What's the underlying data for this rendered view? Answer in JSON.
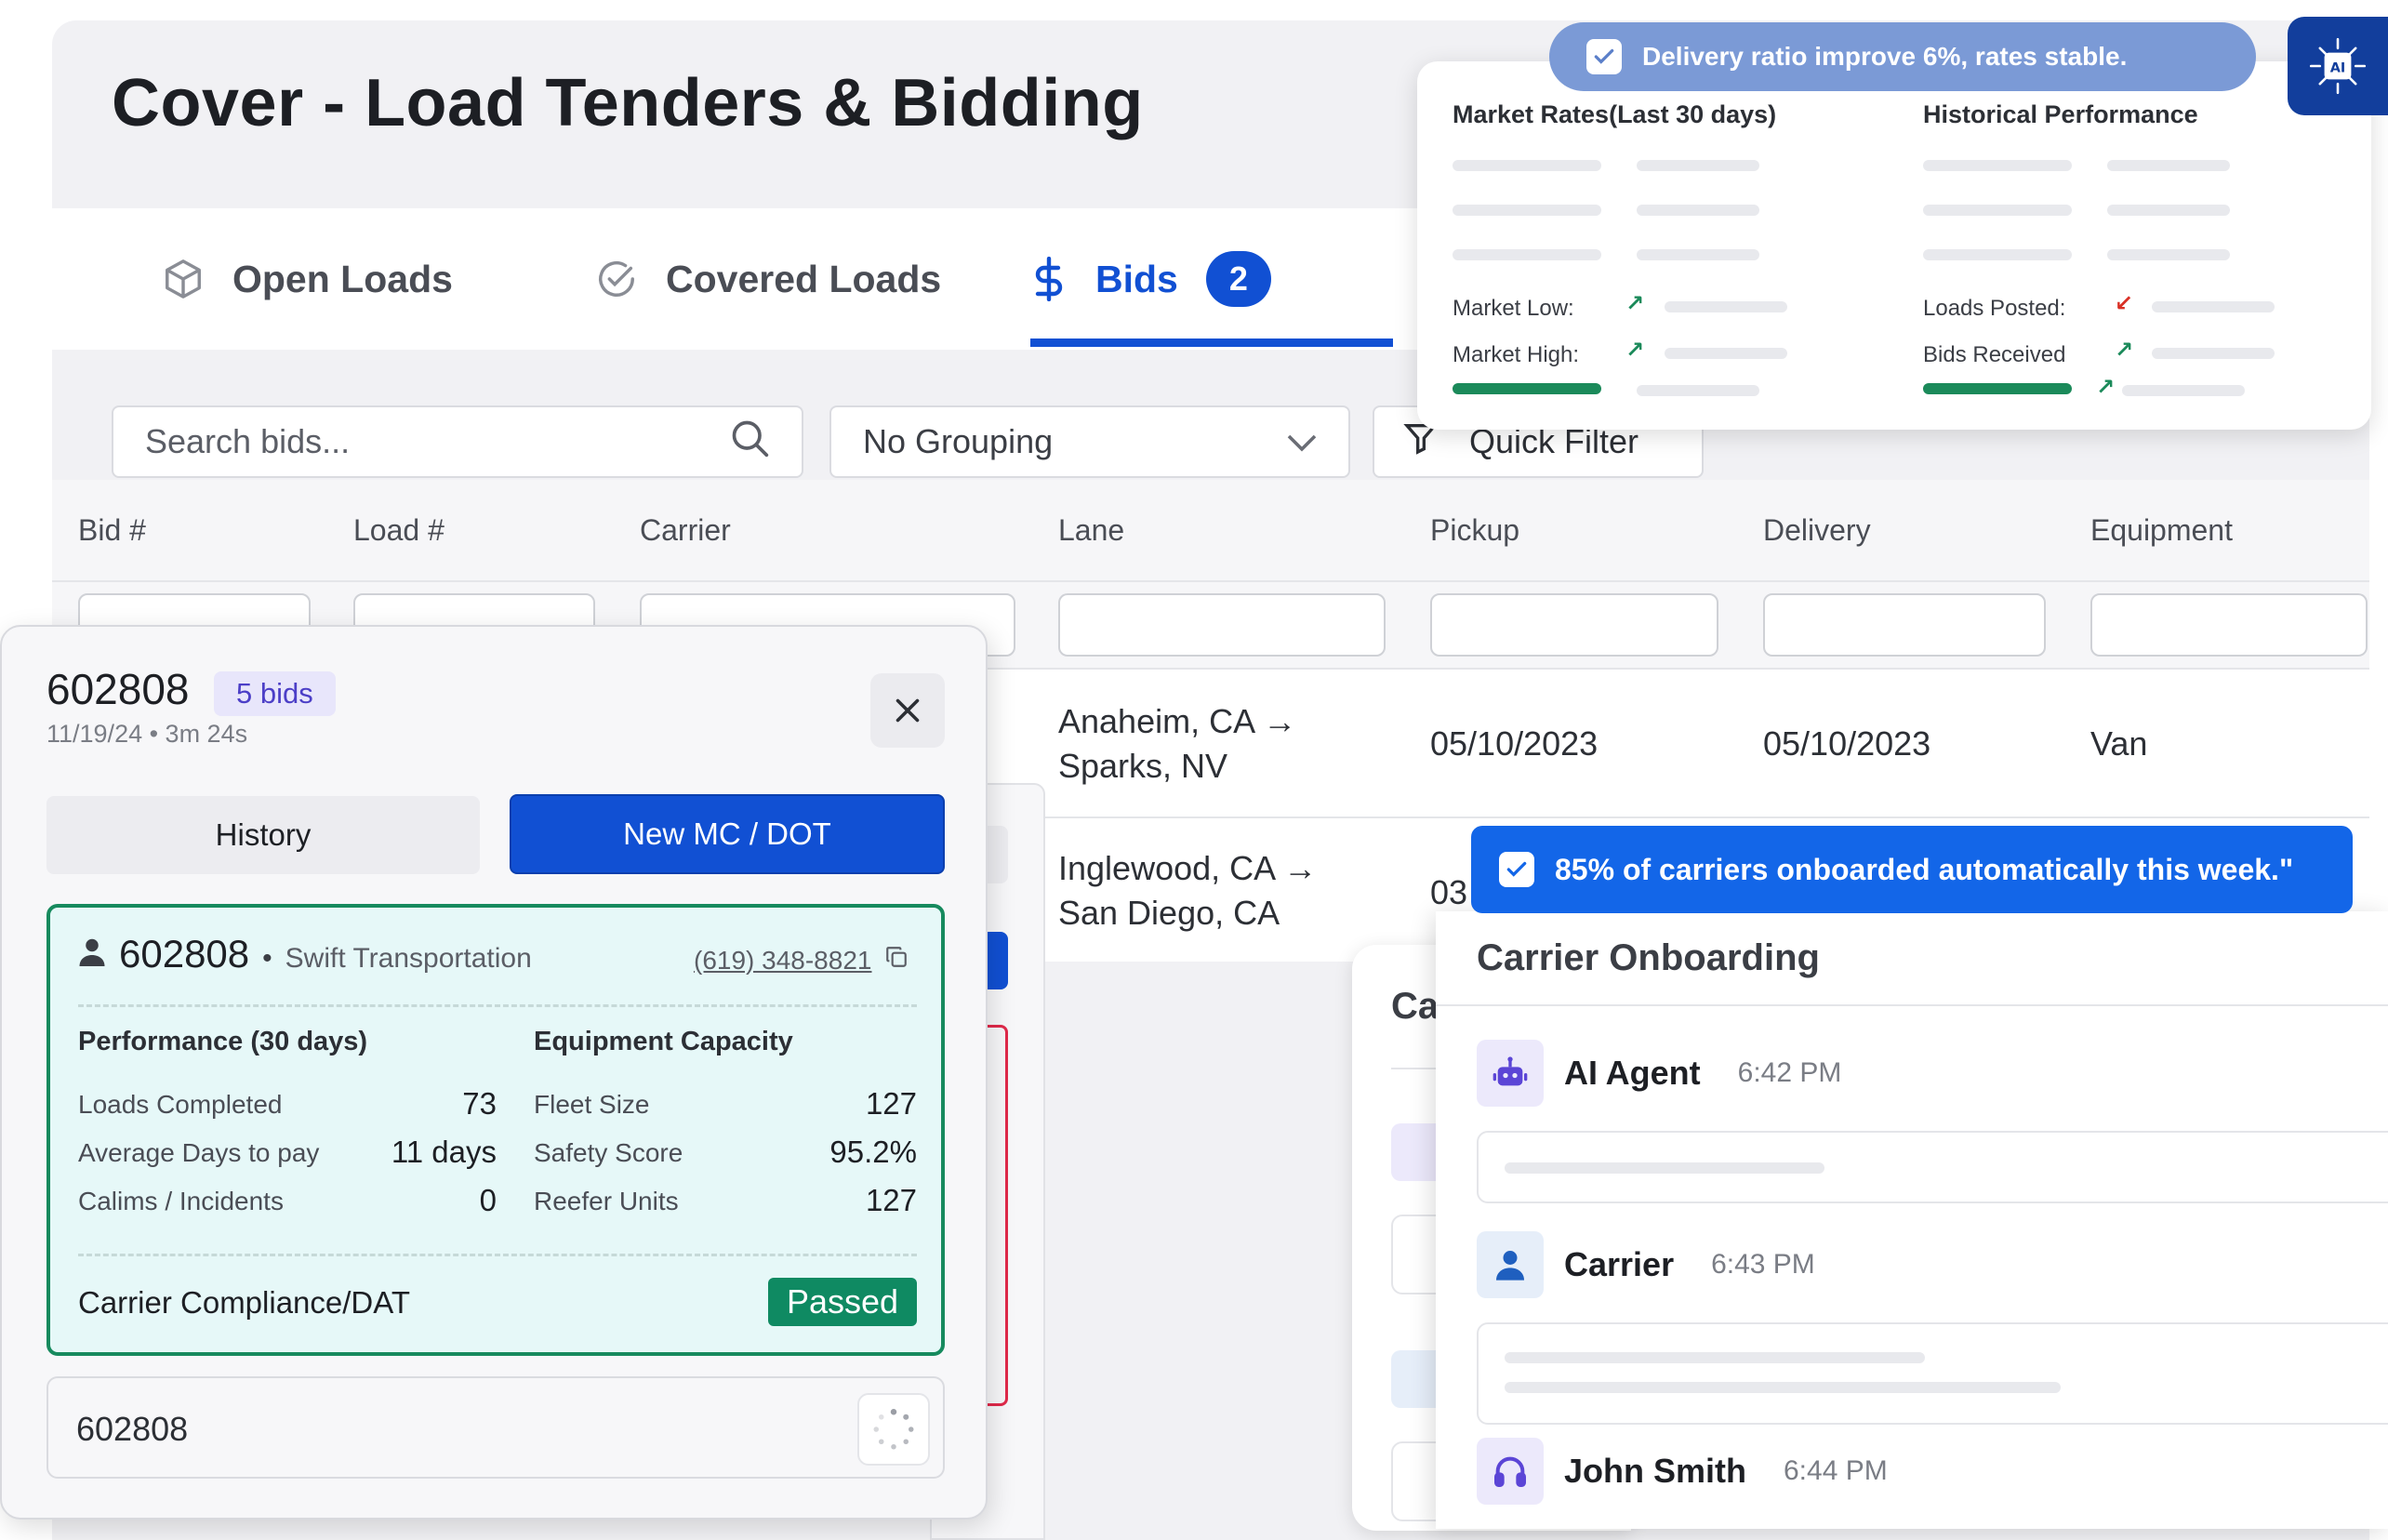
{
  "page": {
    "title": "Cover - Load Tenders & Bidding"
  },
  "tabs": [
    {
      "label": "Open Loads"
    },
    {
      "label": "Covered Loads"
    },
    {
      "label": "Bids",
      "badge": "2"
    }
  ],
  "toolbar": {
    "search_placeholder": "Search bids...",
    "grouping": "No Grouping",
    "quick_filter": "Quick Filter"
  },
  "table": {
    "headers": [
      "Bid #",
      "Load #",
      "Carrier",
      "Lane",
      "Pickup",
      "Delivery",
      "Equipment"
    ],
    "rows": [
      {
        "lane_from": "Anaheim, CA →",
        "lane_to": "Sparks, NV",
        "pickup": "05/10/2023",
        "delivery": "05/10/2023",
        "equipment": "Van"
      },
      {
        "lane_from": "Inglewood, CA →",
        "lane_to": "San Diego, CA",
        "pickup": "03"
      }
    ]
  },
  "market_panel": {
    "banner": "Delivery ratio improve 6%, rates stable.",
    "market_title": "Market Rates(Last 30 days)",
    "history_title": "Historical Performance",
    "market_low": "Market Low:",
    "market_high": "Market High:",
    "loads_posted": "Loads Posted:",
    "bids_received": "Bids Received",
    "ai_badge": "AI"
  },
  "onboarding": {
    "banner": "85% of carriers onboarded automatically this week.\"",
    "title": "Carrier Onboarding",
    "back_title": "Ca",
    "messages": [
      {
        "name": "AI Agent",
        "time": "6:42 PM"
      },
      {
        "name": "Carrier",
        "time": "6:43 PM"
      },
      {
        "name": "John Smith",
        "time": "6:44 PM"
      }
    ]
  },
  "bid_card": {
    "bid_number": "602808",
    "bids_count": "5 bids",
    "subtitle": "11/19/24 • 3m 24s",
    "history_button": "History",
    "new_mc_button": "New MC / DOT",
    "carrier": {
      "id": "602808",
      "separator": "•",
      "name": "Swift Transportation",
      "phone": "(619) 348-8821"
    },
    "performance": {
      "title": "Performance (30 days)",
      "items": [
        {
          "label": "Loads Completed",
          "value": "73"
        },
        {
          "label": "Average Days to pay",
          "value": "11 days"
        },
        {
          "label": "Calims / Incidents",
          "value": "0"
        }
      ]
    },
    "capacity": {
      "title": "Equipment Capacity",
      "items": [
        {
          "label": "Fleet Size",
          "value": "127"
        },
        {
          "label": "Safety Score",
          "value": "95.2%"
        },
        {
          "label": "Reefer Units",
          "value": "127"
        }
      ]
    },
    "compliance_label": "Carrier Compliance/DAT",
    "compliance_status": "Passed",
    "mc_input_value": "602808"
  },
  "colors": {
    "primary": "#1150d3",
    "success": "#0f8a62",
    "banner_muted": "#7b9ad6",
    "banner_bright": "#1366e8",
    "carrier_card_bg": "#e6f8f8"
  }
}
